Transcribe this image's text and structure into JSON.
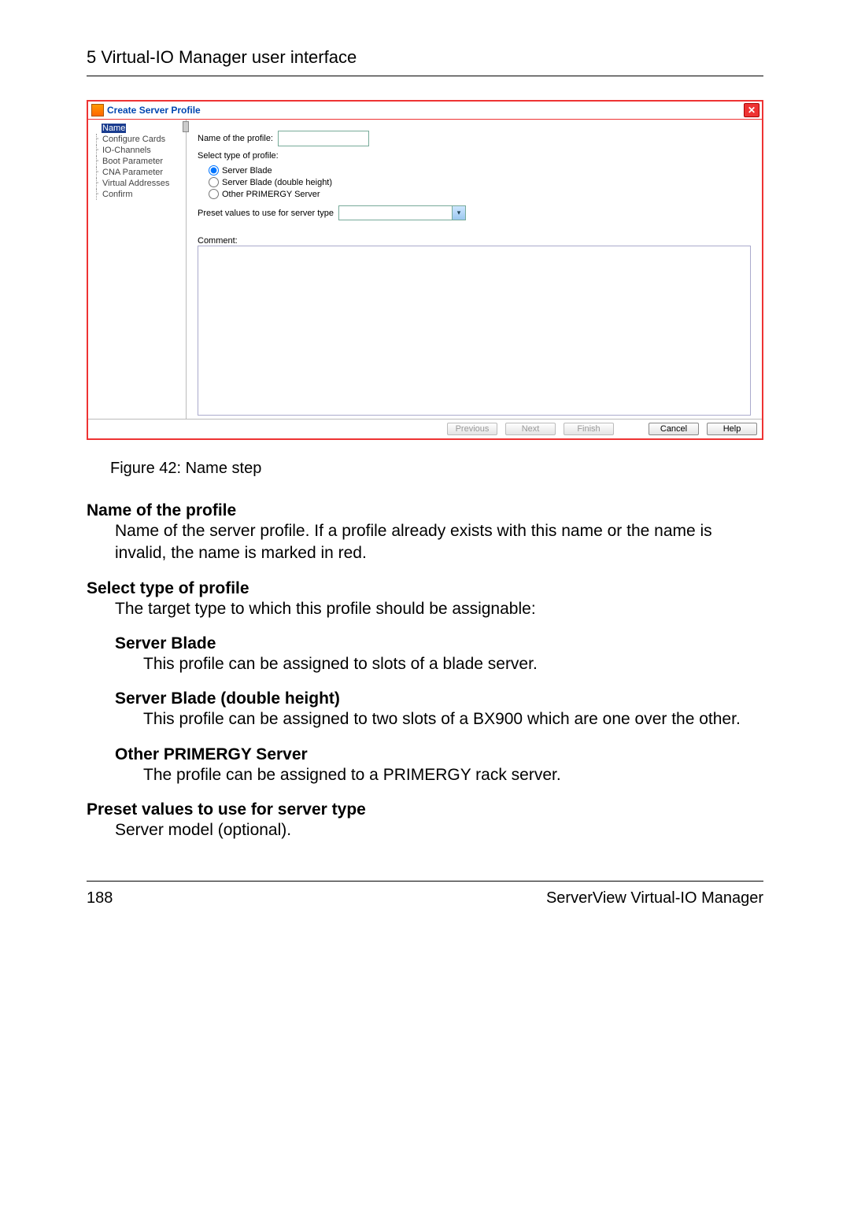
{
  "header": {
    "chapter": "5 Virtual-IO Manager user interface"
  },
  "dialog": {
    "title": "Create Server Profile",
    "close_glyph": "✕",
    "steps": [
      "Name",
      "Configure Cards",
      "IO-Channels",
      "Boot Parameter",
      "CNA Parameter",
      "Virtual Addresses",
      "Confirm"
    ],
    "name_label": "Name of the profile:",
    "select_label": "Select type of profile:",
    "radio_server_blade": "Server Blade",
    "radio_double": "Server Blade (double height)",
    "radio_other": "Other PRIMERGY Server",
    "preset_label": "Preset values to use for server type",
    "combo_glyph": "▾",
    "comment_label": "Comment:",
    "btn_previous": "Previous",
    "btn_next": "Next",
    "btn_finish": "Finish",
    "btn_cancel": "Cancel",
    "btn_help": "Help"
  },
  "figure_caption": "Figure 42: Name step",
  "t1": "Name of the profile",
  "b1": "Name of the server profile. If a profile already exists with this name or the name is invalid, the name is marked in red.",
  "t2": "Select type of profile",
  "b2": "The target type to which this profile should be assignable:",
  "st1": "Server Blade",
  "sb1": "This profile can be assigned to slots of a blade server.",
  "st2": "Server Blade (double height)",
  "sb2": "This profile can be assigned to two slots of a BX900 which are one over the other.",
  "st3": "Other PRIMERGY Server",
  "sb3": "The profile can be assigned to a PRIMERGY rack server.",
  "t3": "Preset values to use for server type",
  "b3": "Server model (optional).",
  "footer": {
    "page": "188",
    "product": "ServerView Virtual-IO Manager"
  }
}
